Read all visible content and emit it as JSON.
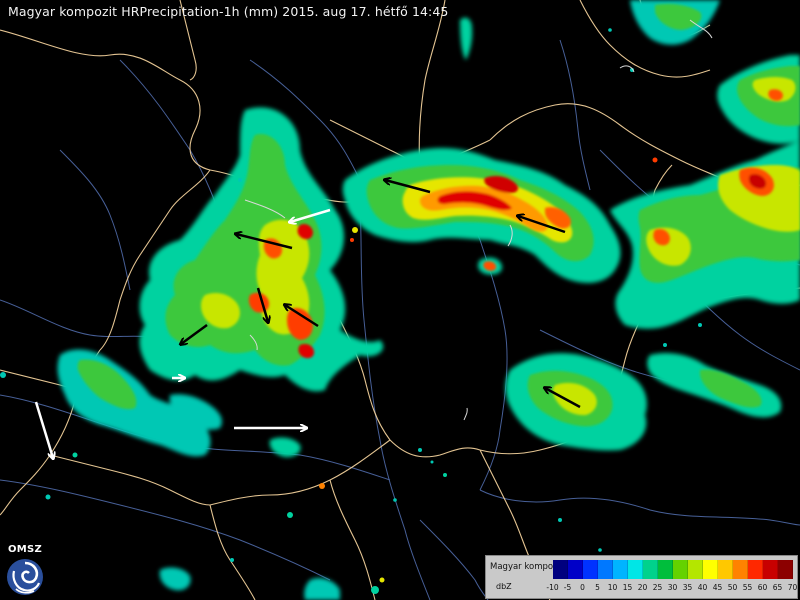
{
  "title": "Magyar kompozit HRPrecipitation-1h (mm) 2015. aug 17. hétfő 14:45",
  "logo": {
    "text": "OMSZ",
    "icon": "omsz-swirl-logo"
  },
  "legend": {
    "title": "Magyar kompozit",
    "unit": "dbZ",
    "ticks": [
      "-10",
      "-5",
      "0",
      "5",
      "10",
      "15",
      "20",
      "25",
      "30",
      "35",
      "40",
      "45",
      "50",
      "55",
      "60",
      "65",
      "70"
    ],
    "colors": [
      "#00007f",
      "#0000c8",
      "#0032ff",
      "#0078ff",
      "#00b4ff",
      "#00e6e6",
      "#00d28c",
      "#00be3c",
      "#64d200",
      "#b4e600",
      "#ffff00",
      "#ffc800",
      "#ff8200",
      "#ff2800",
      "#c80000",
      "#8c0000"
    ]
  },
  "colors": {
    "background": "#000000",
    "borders": "#f0cf9a",
    "rivers": "#5a76b4",
    "arrow_white": "#ffffff",
    "arrow_black": "#000000"
  }
}
